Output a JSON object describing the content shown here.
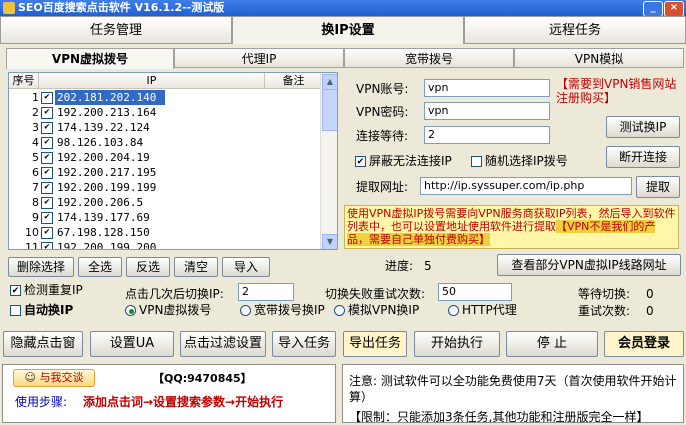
{
  "window": {
    "title": "SEO百度搜索点击软件 V16.1.2--测试版",
    "min": "_",
    "close": "×"
  },
  "main_tabs": [
    "任务管理",
    "换IP设置",
    "远程任务"
  ],
  "sub_tabs": [
    "VPN虚拟拨号",
    "代理IP",
    "宽带拨号",
    "VPN模拟"
  ],
  "list": {
    "headers": [
      "序号",
      "IP",
      "备注"
    ],
    "rows": [
      {
        "num": "1",
        "ip": "202.181.202.140"
      },
      {
        "num": "2",
        "ip": "192.200.213.164"
      },
      {
        "num": "3",
        "ip": "174.139.22.124"
      },
      {
        "num": "4",
        "ip": "98.126.103.84"
      },
      {
        "num": "5",
        "ip": "192.200.204.19"
      },
      {
        "num": "6",
        "ip": "192.200.217.195"
      },
      {
        "num": "7",
        "ip": "192.200.199.199"
      },
      {
        "num": "8",
        "ip": "192.200.206.5"
      },
      {
        "num": "9",
        "ip": "174.139.177.69"
      },
      {
        "num": "10",
        "ip": "67.198.128.150"
      },
      {
        "num": "11",
        "ip": "192.200.199.200"
      }
    ]
  },
  "list_buttons": [
    "删除选择",
    "全选",
    "反选",
    "清空",
    "导入"
  ],
  "vpn": {
    "account_label": "VPN账号:",
    "account_value": "vpn",
    "password_label": "VPN密码:",
    "password_value": "vpn",
    "wait_label": "连接等待:",
    "wait_value": "2",
    "buy_note": "【需要到VPN销售网站注册购买】",
    "test_button": "测试换IP",
    "disconnect_button": "断开连接",
    "block_label": "屏蔽无法连接IP",
    "random_label": "随机选择IP拨号",
    "fetch_label": "提取网址:",
    "fetch_url": "http://ip.syssuper.com/ip.php",
    "fetch_button": "提取",
    "warning_red": "使用VPN虚拟IP拨号需要向VPN服务商获取IP列表，然后导入到软件列表中，也可以设置地址使用软件进行提取",
    "warning_highlight": "【VPN不是我们的产品，需要自己单独付费购买】",
    "progress_label": "进度:",
    "progress_value": "5",
    "view_lines_button": "查看部分VPN虚拟IP线路网址"
  },
  "options": {
    "dup_check": "检测重复IP",
    "auto_switch": "自动换IP",
    "clicks_label": "点击几次后切换IP:",
    "clicks_value": "2",
    "retry_label": "切换失败重试次数:",
    "retry_value": "50",
    "wait_switch_label": "等待切换:",
    "wait_switch_value": "0",
    "retry_count_label": "重试次数:",
    "retry_count_value": "0",
    "modes": [
      "VPN虚拟拨号",
      "宽带拨号换IP",
      "模拟VPN换IP",
      "HTTP代理"
    ]
  },
  "toolbar": [
    "隐藏点击窗",
    "设置UA",
    "点击过滤设置",
    "导入任务",
    "导出任务",
    "开始执行",
    "停 止",
    "会员登录"
  ],
  "bottom_left": {
    "qq_button": "与我交谈",
    "qq_number": "【QQ:9470845】",
    "steps_label": "使用步骤:",
    "steps_text": "添加点击词→设置搜索参数→开始执行"
  },
  "bottom_right": {
    "notice": "注意: 测试软件可以全功能免费使用7天（首次使用软件开始计算）",
    "limit": "【限制：只能添加3条任务,其他功能和注册版完全一样】"
  }
}
